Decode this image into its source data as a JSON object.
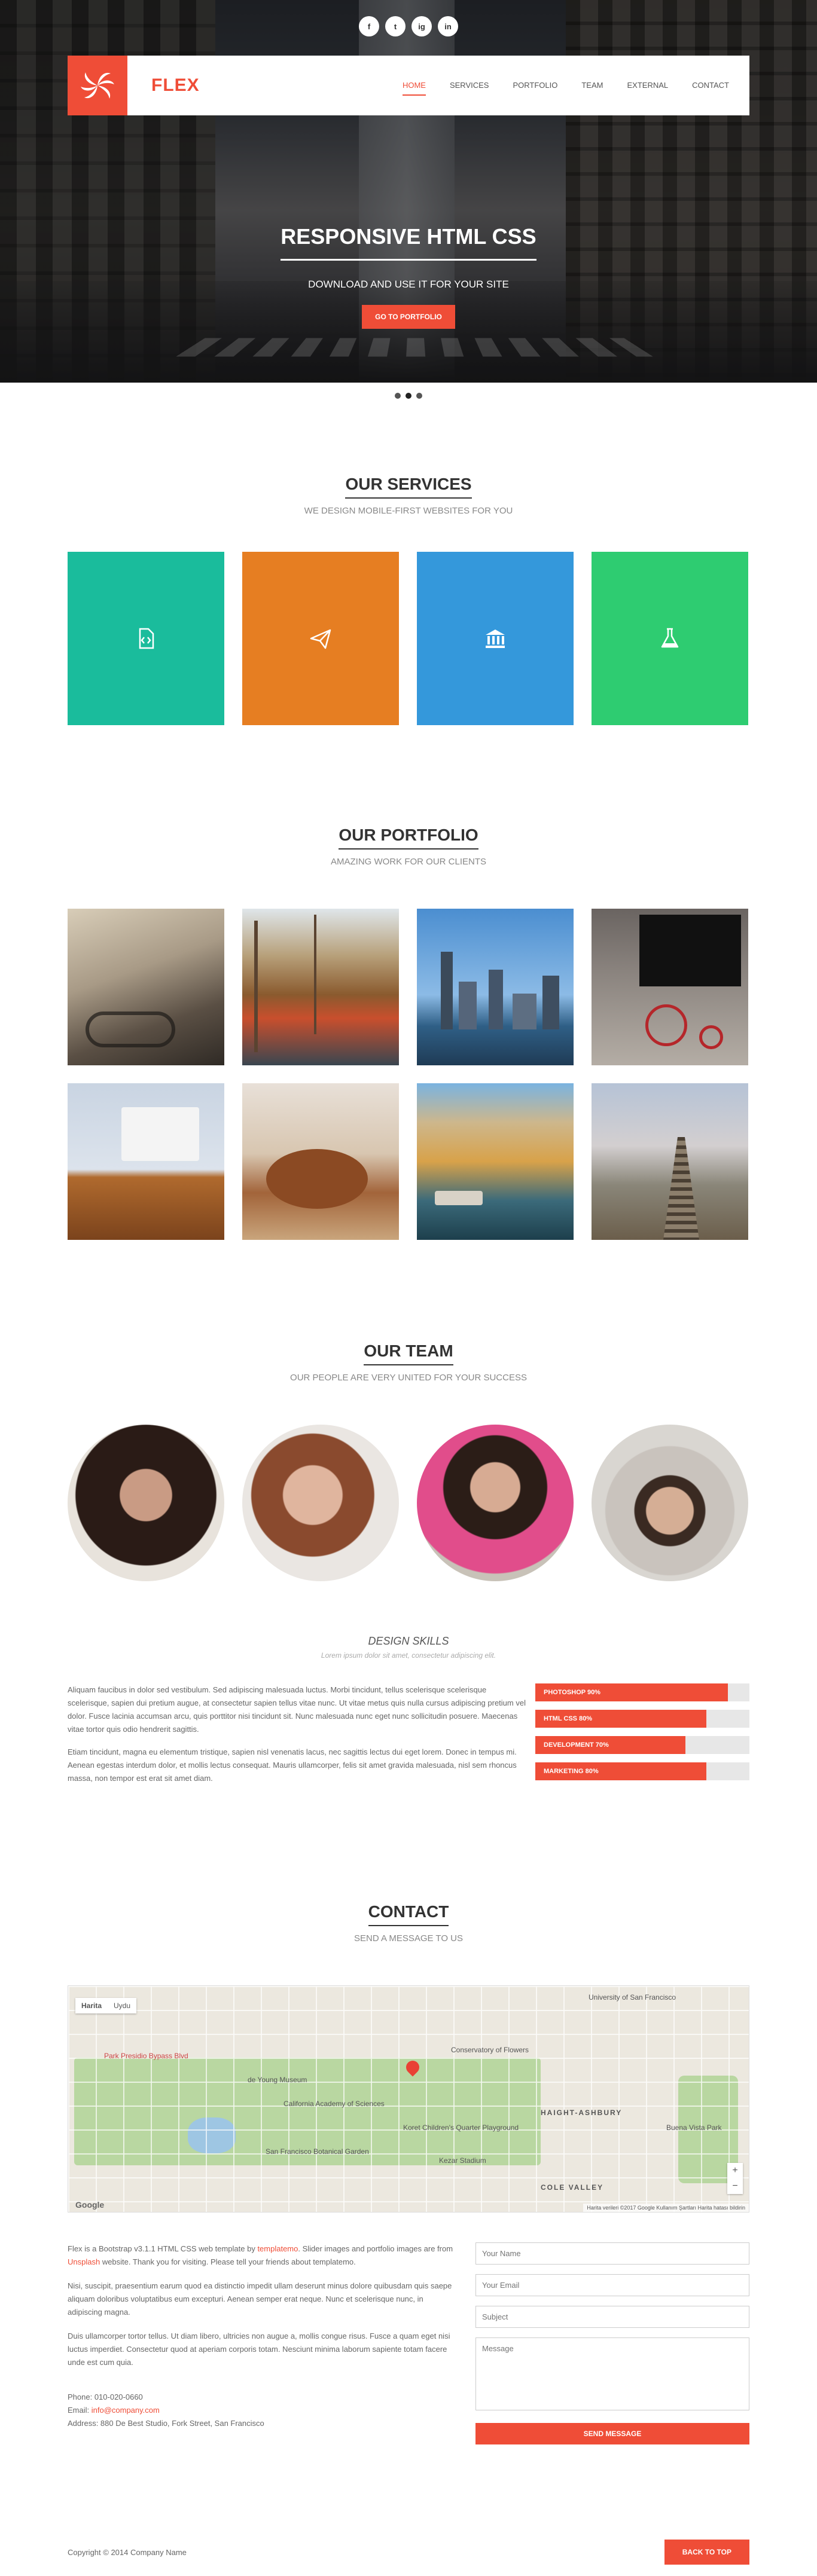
{
  "social": [
    "f",
    "t",
    "ig",
    "in"
  ],
  "brand": {
    "name": "FLEX"
  },
  "nav": [
    "HOME",
    "SERVICES",
    "PORTFOLIO",
    "TEAM",
    "EXTERNAL",
    "CONTACT"
  ],
  "hero": {
    "title": "RESPONSIVE HTML CSS",
    "subtitle": "DOWNLOAD AND USE IT FOR YOUR SITE",
    "button": "GO TO PORTFOLIO"
  },
  "services": {
    "title": "OUR SERVICES",
    "subtitle": "WE DESIGN MOBILE-FIRST WEBSITES FOR YOU",
    "tiles": [
      {
        "icon": "code-file-icon",
        "color": "#1abc9c"
      },
      {
        "icon": "paper-plane-icon",
        "color": "#e67e22"
      },
      {
        "icon": "bank-icon",
        "color": "#3498db"
      },
      {
        "icon": "flask-icon",
        "color": "#2ecc71"
      }
    ]
  },
  "portfolio": {
    "title": "OUR PORTFOLIO",
    "subtitle": "AMAZING WORK FOR OUR CLIENTS"
  },
  "team": {
    "title": "OUR TEAM",
    "subtitle": "OUR PEOPLE ARE VERY UNITED FOR YOUR SUCCESS"
  },
  "skills": {
    "title": "DESIGN SKILLS",
    "subtitle": "Lorem ipsum dolor sit amet, consectetur adipiscing elit.",
    "para1": "Aliquam faucibus in dolor sed vestibulum. Sed adipiscing malesuada luctus. Morbi tincidunt, tellus scelerisque scelerisque scelerisque, sapien dui pretium augue, at consectetur sapien tellus vitae nunc. Ut vitae metus quis nulla cursus adipiscing pretium vel dolor. Fusce lacinia accumsan arcu, quis porttitor nisi tincidunt sit. Nunc malesuada nunc eget nunc sollicitudin posuere. Maecenas vitae tortor quis odio hendrerit sagittis.",
    "para2": "Etiam tincidunt, magna eu elementum tristique, sapien nisl venenatis lacus, nec sagittis lectus dui eget lorem. Donec in tempus mi. Aenean egestas interdum dolor, et mollis lectus consequat. Mauris ullamcorper, felis sit amet gravida malesuada, nisl sem rhoncus massa, non tempor est erat sit amet diam.",
    "bars": [
      {
        "label": "PHOTOSHOP 90%",
        "value": 0.9
      },
      {
        "label": "HTML CSS 80%",
        "value": 0.8
      },
      {
        "label": "DEVELOPMENT 70%",
        "value": 0.7
      },
      {
        "label": "MARKETING 80%",
        "value": 0.8
      }
    ]
  },
  "contact": {
    "title": "CONTACT",
    "subtitle": "SEND A MESSAGE TO US",
    "map": {
      "type_map": "Harita",
      "type_sat": "Uydu",
      "labels": [
        "Park Presidio Bypass Blvd",
        "de Young Museum",
        "California Academy of Sciences",
        "San Francisco Botanical Garden",
        "Koret Children's Quarter Playground",
        "Kezar Stadium",
        "HAIGHT-ASHBURY",
        "COLE VALLEY",
        "Conservatory of Flowers",
        "Buena Vista Park",
        "University of San Francisco"
      ],
      "footer": "Harita verileri ©2017 Google   Kullanım Şartları   Harita hatası bildirin",
      "google": "Google"
    },
    "text1_a": "Flex is a Bootstrap v3.1.1 HTML CSS web template by ",
    "text1_link": "templatemo",
    "text1_b": ". Slider images and portfolio images are from ",
    "text1_link2": "Unsplash",
    "text1_c": " website. Thank you for visiting. Please tell your friends about templatemo.",
    "text2": "Nisi, suscipit, praesentium earum quod ea distinctio impedit ullam deserunt minus dolore quibusdam quis saepe aliquam doloribus voluptatibus eum excepturi. Aenean semper erat neque. Nunc et scelerisque nunc, in adipiscing magna.",
    "text3": "Duis ullamcorper tortor tellus. Ut diam libero, ultricies non augue a, mollis congue risus. Fusce a quam eget nisi luctus imperdiet. Consectetur quod at aperiam corporis totam. Nesciunt minima laborum sapiente totam facere unde est cum quia.",
    "phone": "Phone: 010-020-0660",
    "email_label": "Email: ",
    "email": "info@company.com",
    "address": "Address: 880 De Best Studio, Fork Street, San Francisco",
    "form": {
      "name": "Your Name",
      "email": "Your Email",
      "subject": "Subject",
      "message": "Message",
      "send": "SEND MESSAGE"
    }
  },
  "footer": {
    "copy": "Copyright © 2014 Company Name",
    "top": "BACK TO TOP"
  }
}
